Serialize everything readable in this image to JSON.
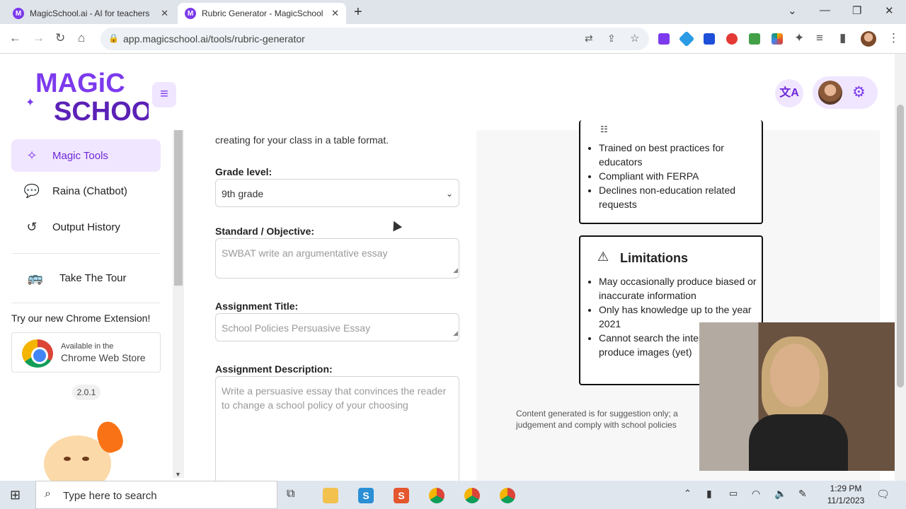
{
  "browser": {
    "tabs": [
      {
        "title": "MagicSchool.ai - AI for teachers",
        "active": false
      },
      {
        "title": "Rubric Generator - MagicSchool",
        "active": true
      }
    ],
    "new_tab": "+",
    "url": "app.magicschool.ai/tools/rubric-generator"
  },
  "header": {
    "logo_line1": "MAGiC",
    "logo_line2": "SCHOOL",
    "menu_icon": "hamburger-icon",
    "translate_icon": "translate-icon",
    "settings_icon": "gear-icon"
  },
  "sidebar": {
    "items": [
      {
        "label": "Magic Tools",
        "icon": "sparkles-icon",
        "active": true
      },
      {
        "label": "Raina (Chatbot)",
        "icon": "chat-icon",
        "active": false
      },
      {
        "label": "Output History",
        "icon": "history-icon",
        "active": false
      }
    ],
    "tour": {
      "label": "Take The Tour",
      "icon": "bus-icon"
    },
    "extension_prompt": "Try our new Chrome Extension!",
    "store_badge": {
      "line1": "Available in the",
      "line2": "Chrome Web Store"
    },
    "version": "2.0.1"
  },
  "form": {
    "intro_partial": "creating for your class in a table format.",
    "grade_label": "Grade level:",
    "grade_value": "9th grade",
    "standard_label": "Standard / Objective:",
    "standard_placeholder": "SWBAT write an argumentative essay",
    "title_label": "Assignment Title:",
    "title_placeholder": "School Policies Persuasive Essay",
    "description_label": "Assignment Description:",
    "description_placeholder": "Write a persuasive essay that convinces the reader to change a school policy of your choosing"
  },
  "info": {
    "benefits": [
      "Trained on best practices for educators",
      "Compliant with FERPA",
      "Declines non-education related requests"
    ],
    "limitations_title": "Limitations",
    "limitations": [
      "May occasionally produce biased or inaccurate information",
      "Only has knowledge up to the year 2021",
      "Cannot search the internet or produce images (yet)"
    ],
    "disclaimer_line1": "Content generated is for suggestion only; a",
    "disclaimer_line2": "judgement and comply with school policies"
  },
  "taskbar": {
    "search_placeholder": "Type here to search",
    "time": "1:29 PM",
    "date": "11/1/2023"
  }
}
